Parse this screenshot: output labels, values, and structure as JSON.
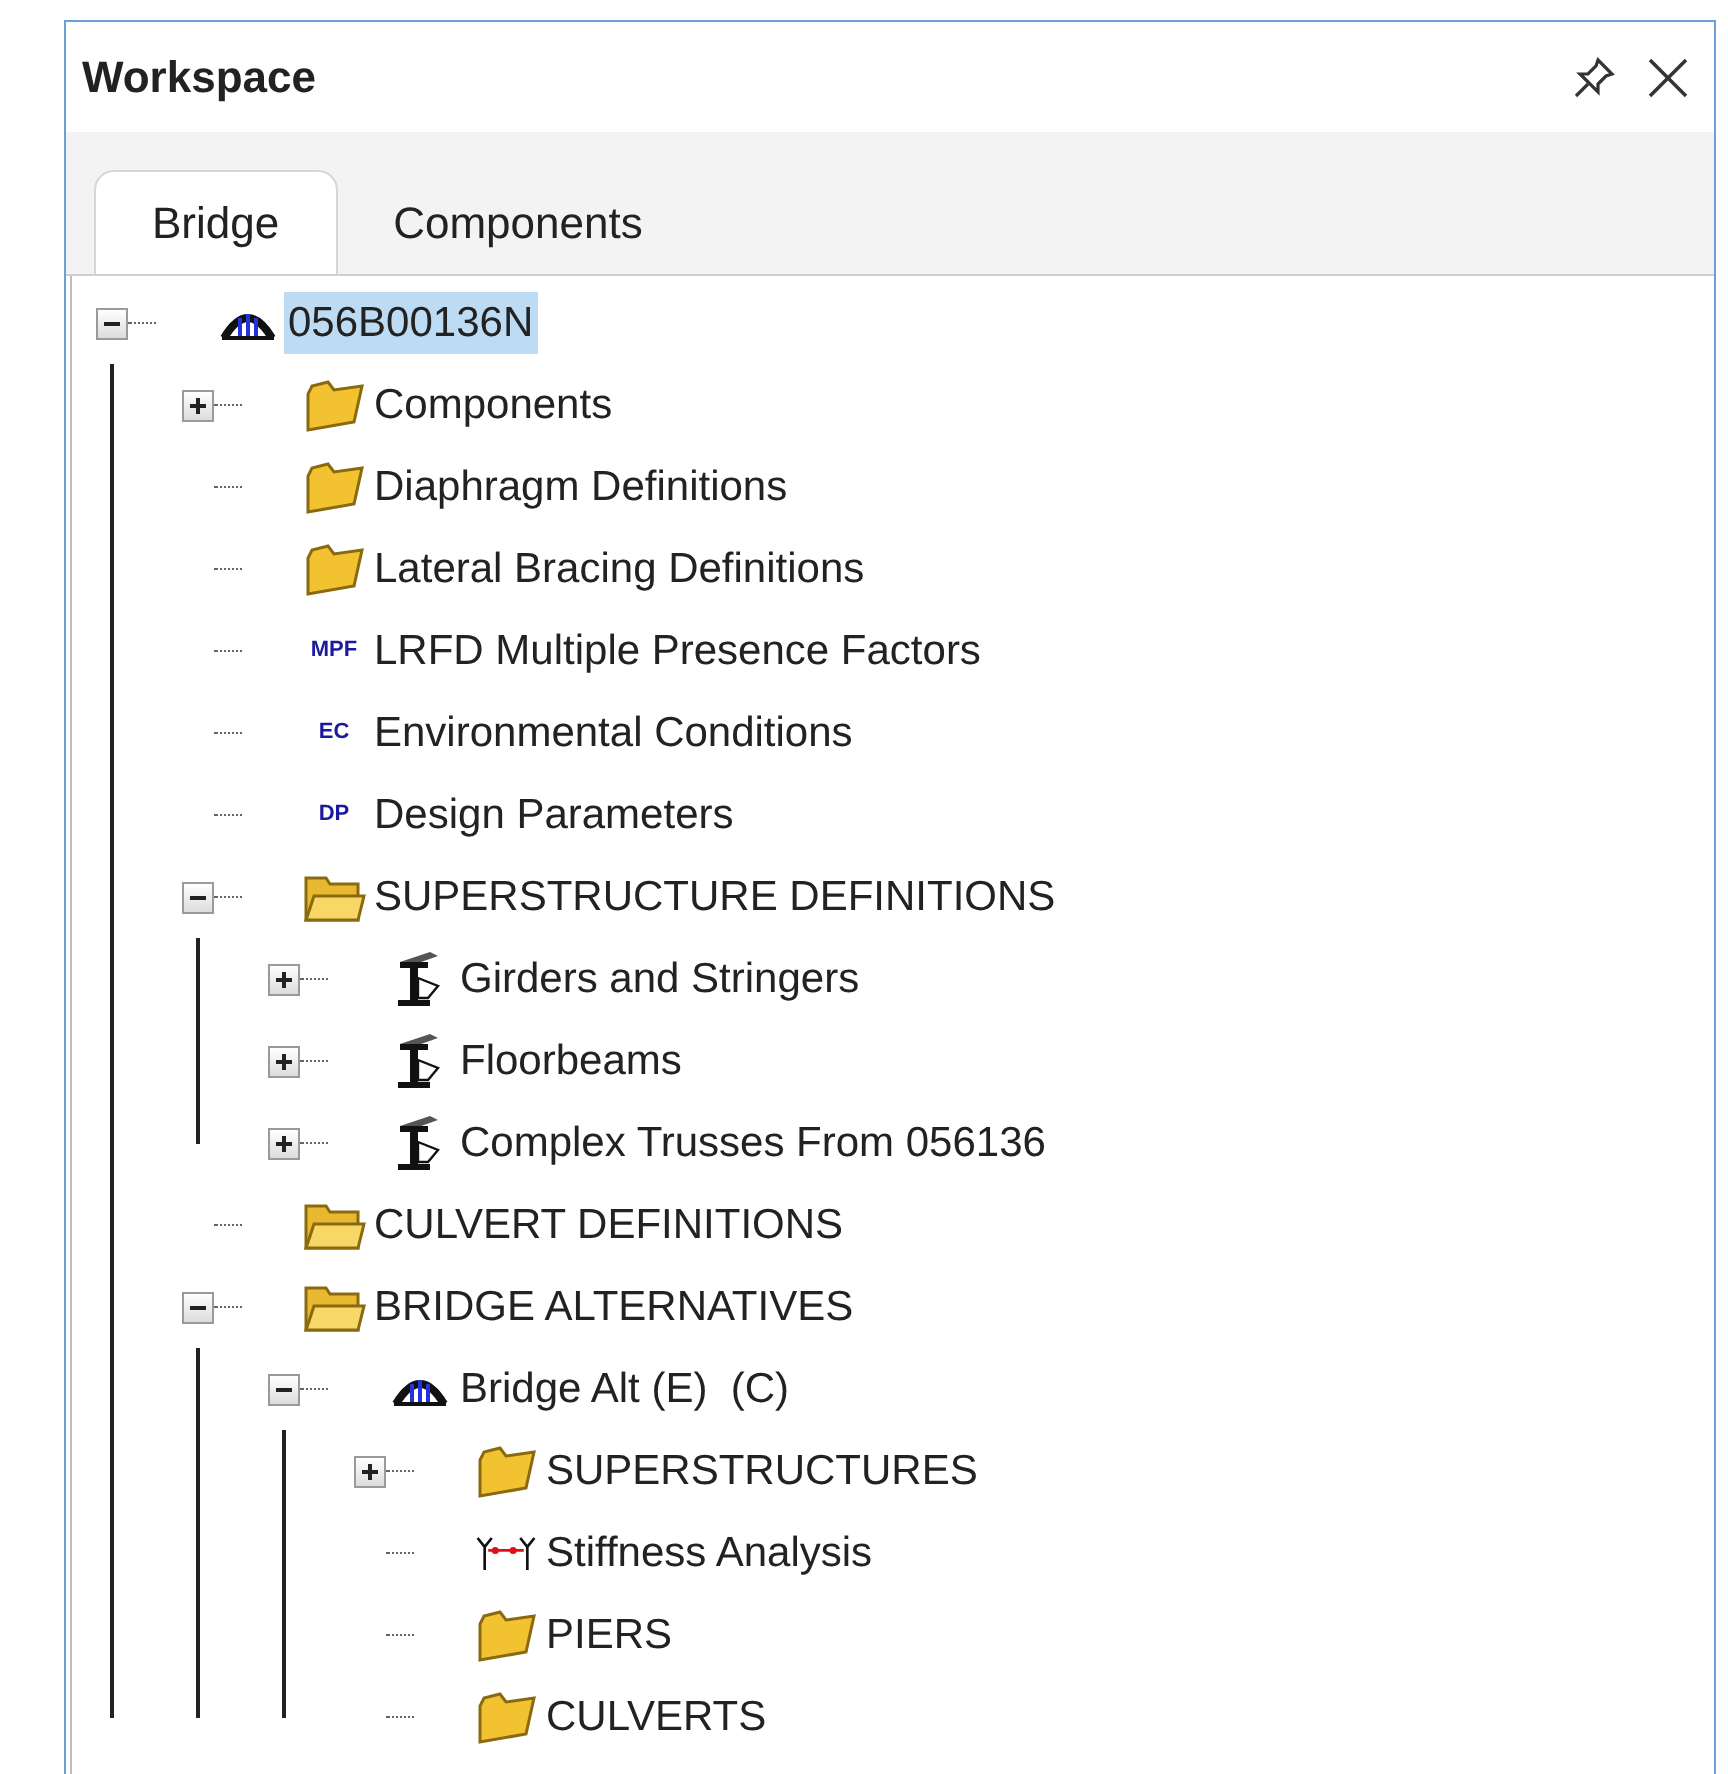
{
  "panel": {
    "title": "Workspace"
  },
  "tabs": [
    {
      "label": "Bridge",
      "selected": true
    },
    {
      "label": "Components",
      "selected": false
    }
  ],
  "tree": [
    {
      "kind": "bridge",
      "label": "056B00136N",
      "selected": true,
      "expanded": true,
      "children": [
        {
          "kind": "folder",
          "label": "Components",
          "selected": false,
          "expanded": false
        },
        {
          "kind": "folder",
          "label": "Diaphragm Definitions",
          "selected": false
        },
        {
          "kind": "folder",
          "label": "Lateral Bracing Definitions",
          "selected": false
        },
        {
          "kind": "code",
          "code": "MPF",
          "label": "LRFD Multiple Presence Factors",
          "selected": false
        },
        {
          "kind": "code",
          "code": "EC",
          "label": "Environmental Conditions",
          "selected": false
        },
        {
          "kind": "code",
          "code": "DP",
          "label": "Design Parameters",
          "selected": false
        },
        {
          "kind": "folder_open",
          "label": "SUPERSTRUCTURE DEFINITIONS",
          "selected": false,
          "expanded": true,
          "children": [
            {
              "kind": "girder",
              "label": "Girders and Stringers",
              "selected": false,
              "expanded": false
            },
            {
              "kind": "girder",
              "label": "Floorbeams",
              "selected": false,
              "expanded": false
            },
            {
              "kind": "girder",
              "label": "Complex Trusses From 056136",
              "selected": false,
              "expanded": false
            }
          ]
        },
        {
          "kind": "folder_open",
          "label": "CULVERT DEFINITIONS",
          "selected": false
        },
        {
          "kind": "folder_open",
          "label": "BRIDGE ALTERNATIVES",
          "selected": false,
          "expanded": true,
          "children": [
            {
              "kind": "bridge",
              "label": "Bridge Alt (E)  (C)",
              "selected": false,
              "expanded": true,
              "children": [
                {
                  "kind": "folder",
                  "label": "SUPERSTRUCTURES",
                  "selected": false,
                  "expanded": false
                },
                {
                  "kind": "stiffness",
                  "label": "Stiffness Analysis",
                  "selected": false
                },
                {
                  "kind": "folder",
                  "label": "PIERS",
                  "selected": false
                },
                {
                  "kind": "folder",
                  "label": "CULVERTS",
                  "selected": false
                }
              ]
            }
          ]
        }
      ]
    }
  ]
}
